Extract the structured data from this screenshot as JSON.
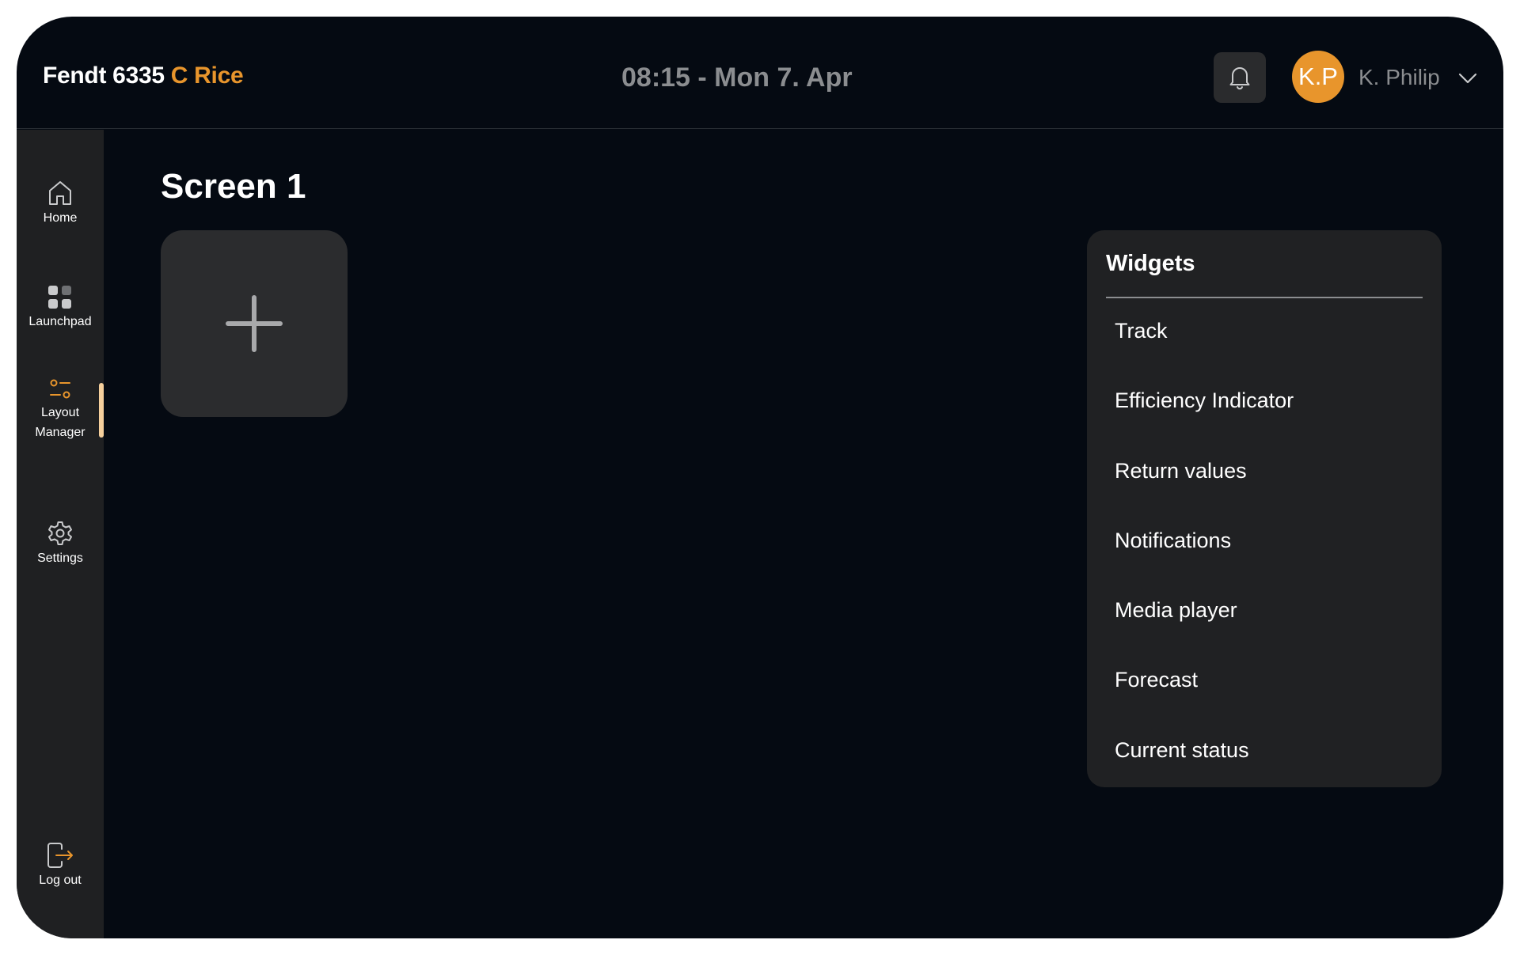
{
  "header": {
    "brand_model": "Fendt 6335",
    "brand_variant": "C Rice",
    "datetime": "08:15 - Mon 7. Apr",
    "notifications_icon": "bell-icon",
    "user_initials": "K.P",
    "user_name": "K. Philip",
    "user_menu_icon": "chevron-down-icon"
  },
  "sidebar": {
    "items": [
      {
        "label": "Home",
        "icon": "home-icon"
      },
      {
        "label": "Launchpad",
        "icon": "grid-icon"
      },
      {
        "label": "Layout Manager",
        "icon": "sliders-icon",
        "active": true
      },
      {
        "label": "Settings",
        "icon": "gear-icon"
      },
      {
        "label": "Log out",
        "icon": "logout-icon"
      }
    ]
  },
  "main": {
    "title": "Screen 1",
    "add_icon": "plus-icon"
  },
  "widgets": {
    "title": "Widgets",
    "items": [
      "Track",
      "Efficiency Indicator",
      "Return values",
      "Notifications",
      "Media player",
      "Forecast",
      "Current status"
    ]
  },
  "colors": {
    "background": "#050a12",
    "accent": "#e8952c",
    "active_indicator": "#f5cf9c",
    "panel": "#202123",
    "muted_text": "#8b8d90"
  }
}
